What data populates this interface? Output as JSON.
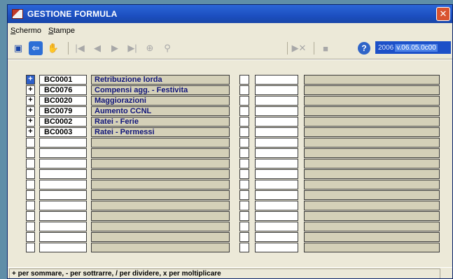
{
  "window": {
    "title": "GESTIONE FORMULA"
  },
  "menu": [
    {
      "first": "S",
      "rest": "chermo"
    },
    {
      "first": "S",
      "rest": "tampe"
    }
  ],
  "toolbar": {
    "icons": [
      "save-icon",
      "back-icon",
      "hand-icon",
      "first-icon",
      "prev-icon",
      "next-icon",
      "last-icon",
      "binoculars-icon",
      "zoom-icon",
      "delete-icon",
      "stop-icon"
    ],
    "help": "?",
    "year": "2006",
    "version": "v.06.05.0c00"
  },
  "rows": [
    {
      "op": "+",
      "code": "BC0001",
      "desc": "Retribuzione lorda"
    },
    {
      "op": "+",
      "code": "BC0076",
      "desc": "Compensi agg. - Festivita"
    },
    {
      "op": "+",
      "code": "BC0020",
      "desc": "Maggiorazioni"
    },
    {
      "op": "+",
      "code": "BC0079",
      "desc": "Aumento CCNL"
    },
    {
      "op": "+",
      "code": "BC0002",
      "desc": "Ratei - Ferie"
    },
    {
      "op": "+",
      "code": "BC0003",
      "desc": "Ratei - Permessi"
    },
    {
      "op": "",
      "code": "",
      "desc": ""
    },
    {
      "op": "",
      "code": "",
      "desc": ""
    },
    {
      "op": "",
      "code": "",
      "desc": ""
    },
    {
      "op": "",
      "code": "",
      "desc": ""
    },
    {
      "op": "",
      "code": "",
      "desc": ""
    },
    {
      "op": "",
      "code": "",
      "desc": ""
    },
    {
      "op": "",
      "code": "",
      "desc": ""
    },
    {
      "op": "",
      "code": "",
      "desc": ""
    },
    {
      "op": "",
      "code": "",
      "desc": ""
    },
    {
      "op": "",
      "code": "",
      "desc": ""
    },
    {
      "op": "",
      "code": "",
      "desc": ""
    }
  ],
  "status": "+ per sommare, - per sottrarre, / per dividere, x per moltiplicare",
  "colors": {
    "titlebar": "#1c4fc0",
    "window_bg": "#ece9d8",
    "desc_text": "#10157a",
    "selected_op": "#2d5fc8"
  }
}
